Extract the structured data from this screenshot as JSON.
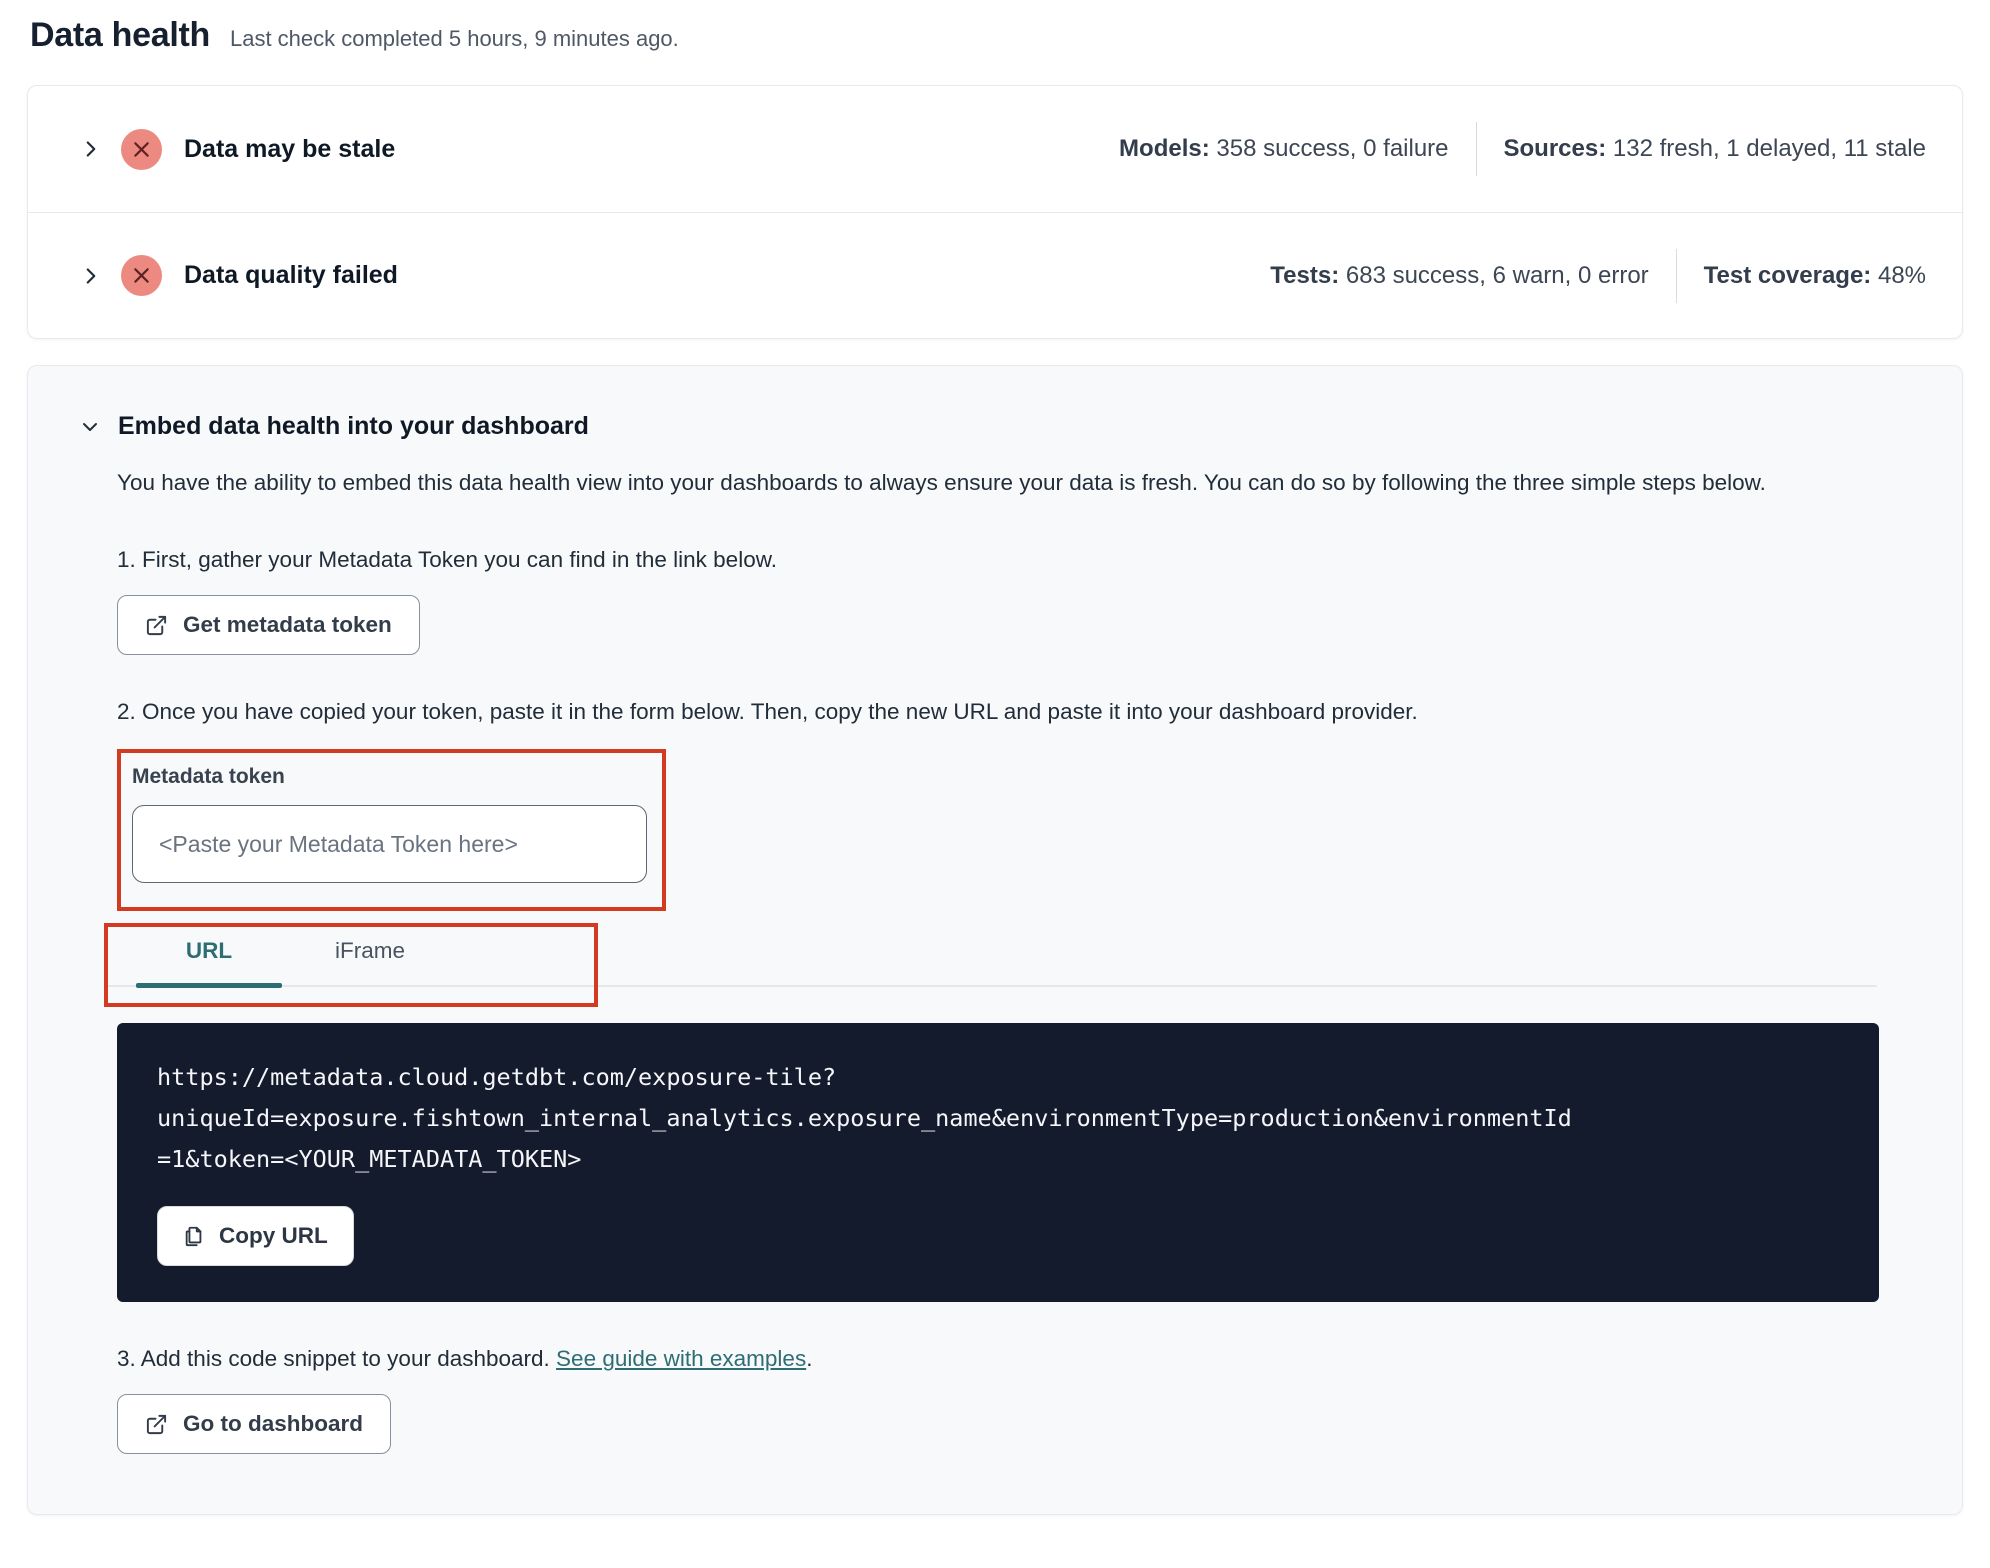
{
  "page": {
    "title": "Data health",
    "subtitle": "Last check completed 5 hours, 9 minutes ago."
  },
  "status_rows": [
    {
      "label": "Data may be stale",
      "stats": [
        {
          "label": "Models:",
          "value": " 358 success, 0 failure"
        },
        {
          "label": "Sources:",
          "value": " 132 fresh, 1 delayed, 11 stale"
        }
      ]
    },
    {
      "label": "Data quality failed",
      "stats": [
        {
          "label": "Tests:",
          "value": " 683 success, 6 warn, 0 error"
        },
        {
          "label": "Test coverage:",
          "value": " 48%"
        }
      ]
    }
  ],
  "embed": {
    "title": "Embed data health into your dashboard",
    "description": "You have the ability to embed this data health view into your dashboards to always ensure your data is fresh. You can do so by following the three simple steps below.",
    "step1": {
      "text": "1. First, gather your Metadata Token you can find in the link below.",
      "button_label": "Get metadata token"
    },
    "step2": {
      "text": "2. Once you have copied your token, paste it in the form below. Then, copy the new URL and paste it into your dashboard provider.",
      "token_label": "Metadata token",
      "token_placeholder": "<Paste your Metadata Token here>",
      "tabs": [
        {
          "label": "URL"
        },
        {
          "label": "iFrame"
        }
      ],
      "code_lines": [
        "https://metadata.cloud.getdbt.com/exposure-tile?",
        "uniqueId=exposure.fishtown_internal_analytics.exposure_name&environmentType=production&environmentId",
        "=1&token=<YOUR_METADATA_TOKEN>"
      ],
      "copy_button_label": "Copy URL"
    },
    "step3": {
      "text_before_link": "3. Add this code snippet to your dashboard. ",
      "link_text": "See guide with examples",
      "text_after_link": ".",
      "button_label": "Go to dashboard"
    }
  },
  "colors": {
    "accent_teal": "#2d6e73",
    "annotation_red": "#d23b21",
    "error_badge_bg": "#ec8a81",
    "error_badge_x": "#5d2222",
    "code_background": "#141b2c"
  }
}
